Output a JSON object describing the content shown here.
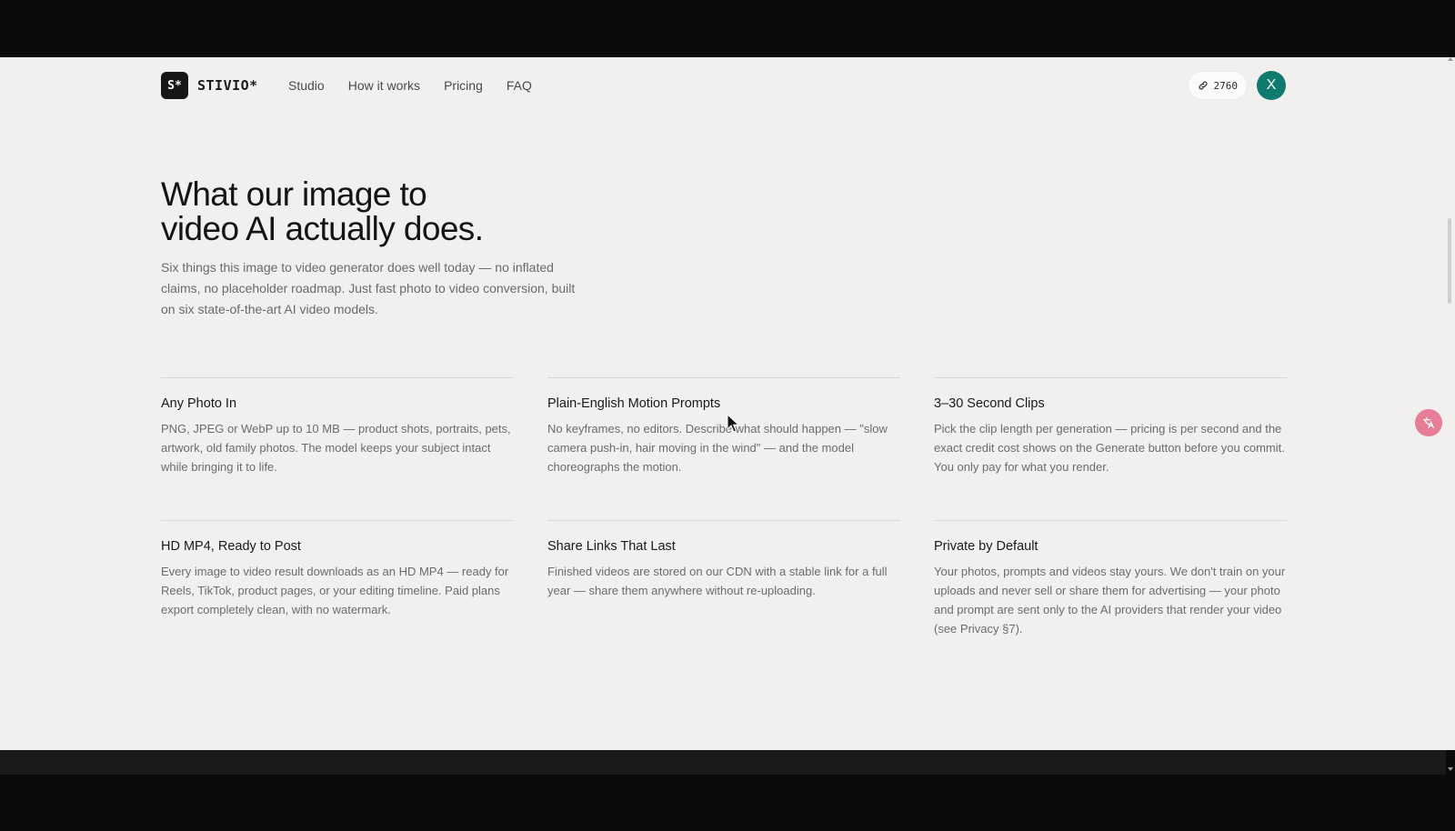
{
  "brand": {
    "logo_mark": "S*",
    "name": "STIVIO*"
  },
  "nav": {
    "items": [
      "Studio",
      "How it works",
      "Pricing",
      "FAQ"
    ]
  },
  "credits": {
    "icon": "link-icon",
    "count": "2760"
  },
  "user": {
    "avatar_initial": "X",
    "avatar_color": "#0f7a6e"
  },
  "hero": {
    "title_line1": "What our image to",
    "title_line2": "video AI actually does.",
    "description": "Six things this image to video generator does well today — no inflated claims, no placeholder roadmap. Just fast photo to video conversion, built on six state-of-the-art AI video models."
  },
  "features": [
    {
      "title": "Any Photo In",
      "description": "PNG, JPEG or WebP up to 10 MB — product shots, portraits, pets, artwork, old family photos. The model keeps your subject intact while bringing it to life."
    },
    {
      "title": "Plain-English Motion Prompts",
      "description": "No keyframes, no editors. Describe what should happen — \"slow camera push-in, hair moving in the wind\" — and the model choreographs the motion."
    },
    {
      "title": "3–30 Second Clips",
      "description": "Pick the clip length per generation — pricing is per second and the exact credit cost shows on the Generate button before you commit. You only pay for what you render."
    },
    {
      "title": "HD MP4, Ready to Post",
      "description": "Every image to video result downloads as an HD MP4 — ready for Reels, TikTok, product pages, or your editing timeline. Paid plans export completely clean, with no watermark."
    },
    {
      "title": "Share Links That Last",
      "description": "Finished videos are stored on our CDN with a stable link for a full year — share them anywhere without re-uploading."
    },
    {
      "title": "Private by Default",
      "description": "Your photos, prompts and videos stay yours. We don't train on your uploads and never sell or share them for advertising — your photo and prompt are sent only to the AI providers that render your video (see Privacy §7)."
    }
  ],
  "colors": {
    "page_bg": "#f1f0ee",
    "text_dark": "#141414",
    "text_muted": "#6a6a6a",
    "accent": "#0f7a6e"
  }
}
